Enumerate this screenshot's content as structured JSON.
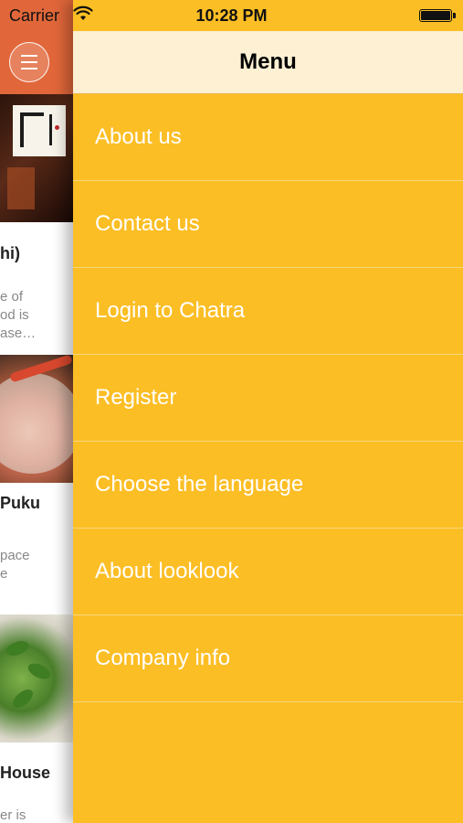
{
  "status_bar": {
    "carrier": "Carrier",
    "time": "10:28 PM",
    "battery_level": 1.0
  },
  "background_screen": {
    "cards": [
      {
        "title": "hi)",
        "desc_lines": [
          "e of",
          "od is",
          "ase…"
        ]
      },
      {
        "title": "Puku",
        "desc_lines": [
          "pace",
          "e"
        ]
      },
      {
        "title": "House",
        "desc_lines": [
          "er is"
        ]
      }
    ]
  },
  "drawer": {
    "title": "Menu",
    "items": [
      {
        "label": "About us"
      },
      {
        "label": "Contact us"
      },
      {
        "label": "Login to Chatra"
      },
      {
        "label": "Register"
      },
      {
        "label": "Choose the language"
      },
      {
        "label": "About looklook"
      },
      {
        "label": "Company info"
      }
    ]
  },
  "colors": {
    "drawer_background": "#fcbe25",
    "drawer_header": "#fdf0d3",
    "app_header": "#e1673a",
    "menu_text": "#ffffff"
  },
  "icons": {
    "menu_button": "hamburger-icon",
    "wifi": "wifi-icon",
    "battery": "battery-icon"
  }
}
